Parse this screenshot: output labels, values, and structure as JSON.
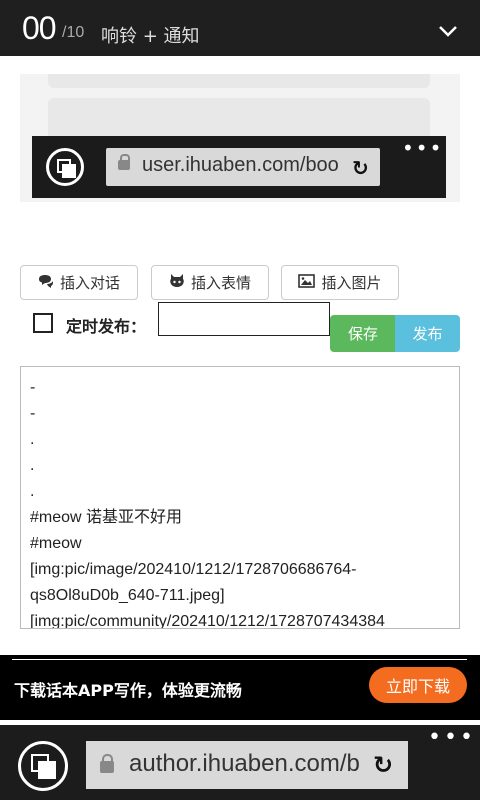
{
  "notification": {
    "count": "00",
    "total": "/10",
    "title": "响铃 + 通知",
    "expand_icon": "chevron-down-icon"
  },
  "embedded_browser": {
    "url": "user.ihuaben.com/boo",
    "reload_icon": "reload-icon",
    "menu": "•••"
  },
  "toolbar": {
    "insert_dialog": "插入对话",
    "insert_emoji": "插入表情",
    "insert_image": "插入图片",
    "icons": [
      "comment-icon",
      "github-icon",
      "image-icon"
    ]
  },
  "schedule": {
    "label": "定时发布：",
    "input_value": "",
    "save_label": "保存",
    "publish_label": "发布"
  },
  "editor": {
    "lines": [
      "-",
      "-",
      ".",
      ".",
      ".",
      "#meow 诺基亚不好用",
      "#meow",
      "[img:pic/image/202410/1212/1728706686764-",
      "qs8Ol8uD0b_640-711.jpeg]",
      "[img:pic/community/202410/1212/1728707434384"
    ]
  },
  "banner": {
    "message": "下载话本APP写作，体验更流畅",
    "download_label": "立即下载"
  },
  "browser": {
    "url": "author.ihuaben.com/b",
    "reload_icon": "reload-icon",
    "menu": "•••"
  },
  "colors": {
    "save": "#5cb85c",
    "publish": "#5bc0de",
    "download": "#f36c1f"
  }
}
